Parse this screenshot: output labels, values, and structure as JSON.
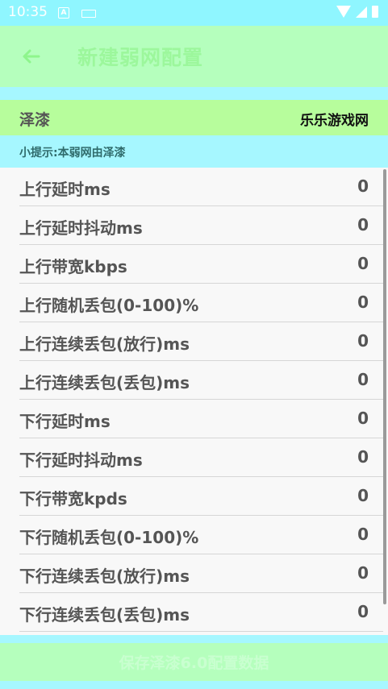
{
  "status_bar": {
    "time": "10:35",
    "icons": [
      "android-icon",
      "keyboard-icon",
      "wifi-icon",
      "signal-icon",
      "battery-icon"
    ]
  },
  "app_bar": {
    "title": "新建弱网配置",
    "back_icon": "arrow-left-icon"
  },
  "group": {
    "label": "泽漆",
    "value": "乐乐游戏网"
  },
  "tip": "小提示:本弱网由泽漆",
  "settings": [
    {
      "label": "上行延时ms",
      "value": "0"
    },
    {
      "label": "上行延时抖动ms",
      "value": "0"
    },
    {
      "label": "上行带宽kbps",
      "value": "0"
    },
    {
      "label": "上行随机丢包(0-100)%",
      "value": "0"
    },
    {
      "label": "上行连续丢包(放行)ms",
      "value": "0"
    },
    {
      "label": "上行连续丢包(丢包)ms",
      "value": "0"
    },
    {
      "label": "下行延时ms",
      "value": "0"
    },
    {
      "label": "下行延时抖动ms",
      "value": "0"
    },
    {
      "label": "下行带宽kpds",
      "value": "0"
    },
    {
      "label": "下行随机丢包(0-100)%",
      "value": "0"
    },
    {
      "label": "下行连续丢包(放行)ms",
      "value": "0"
    },
    {
      "label": "下行连续丢包(丢包)ms",
      "value": "0"
    }
  ],
  "save_button": "保存泽漆6.0配置数据",
  "colors": {
    "status_bar": "#8ff6ff",
    "app_bar": "#b5ffbd",
    "group_row": "#b7fd9c",
    "background": "#a6f7ff",
    "list_bg": "#f8f8f8"
  }
}
